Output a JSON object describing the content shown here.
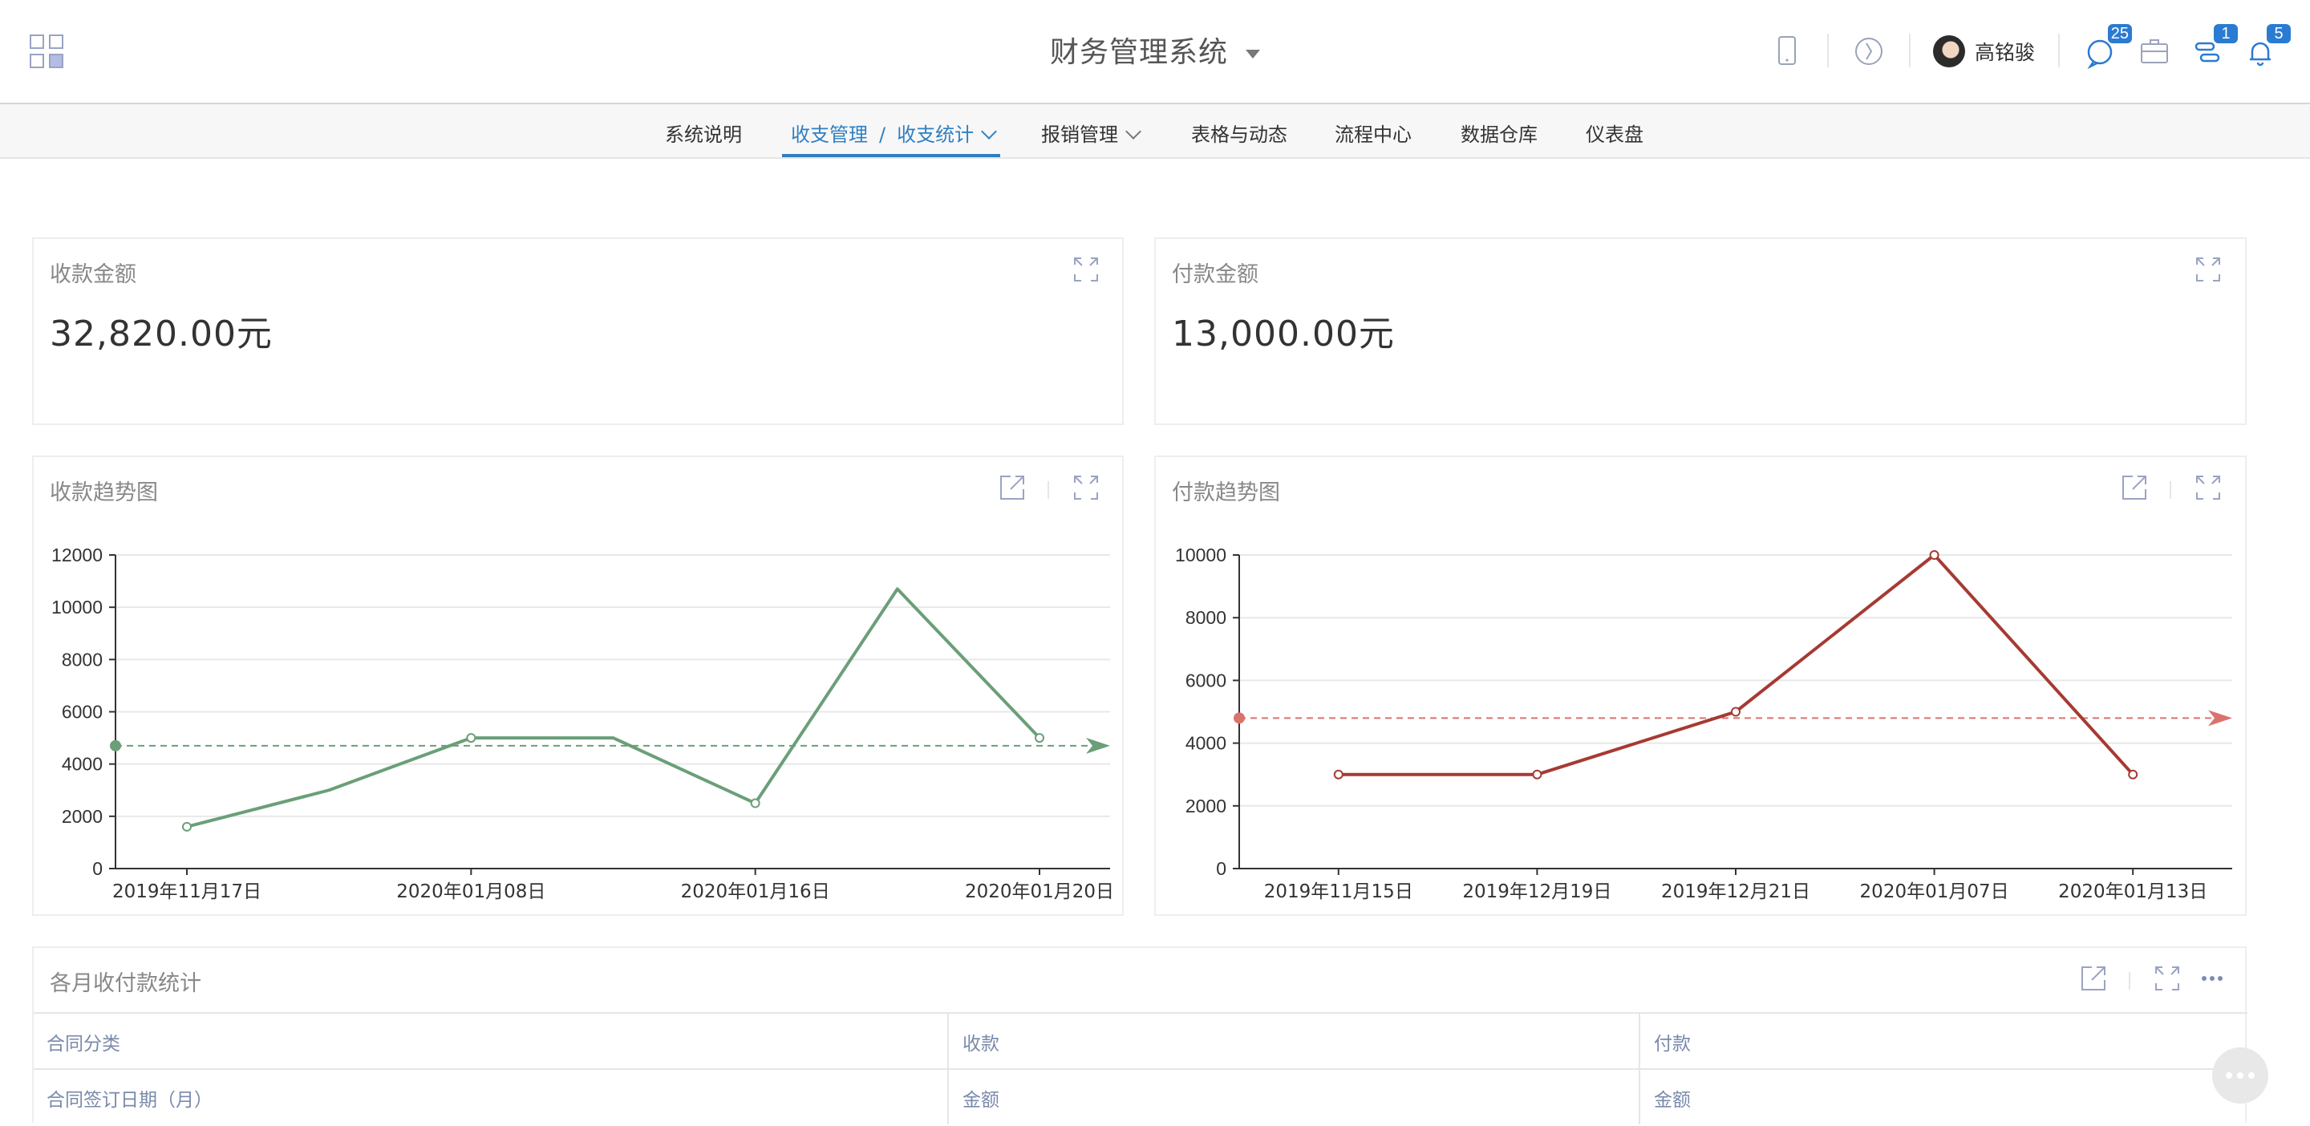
{
  "header": {
    "title": "财务管理系统",
    "user_name": "高铭骏",
    "badges": {
      "messages": "25",
      "tasks": "1",
      "notifications": "5"
    },
    "accent": "#2f7fc1"
  },
  "nav": {
    "items": [
      {
        "label": "系统说明"
      },
      {
        "label": "收支管理",
        "sub": "收支统计",
        "active": true
      },
      {
        "label": "报销管理"
      },
      {
        "label": "表格与动态"
      },
      {
        "label": "流程中心"
      },
      {
        "label": "数据仓库"
      },
      {
        "label": "仪表盘"
      }
    ],
    "separator": "/"
  },
  "kpis": {
    "receipt": {
      "title": "收款金额",
      "value": "32,820.00元"
    },
    "payment": {
      "title": "付款金额",
      "value": "13,000.00元"
    }
  },
  "charts": {
    "receipt_trend_title": "收款趋势图",
    "payment_trend_title": "付款趋势图"
  },
  "chart_data": [
    {
      "type": "line",
      "title": "收款趋势图",
      "color": "#6a9f78",
      "x_tick_labels": [
        "2019年11月17日",
        "2020年01月08日",
        "2020年01月16日",
        "2020年01月20日"
      ],
      "points": [
        {
          "x": "2019年11月17日",
          "y": 1600
        },
        {
          "x": "",
          "y": 3000
        },
        {
          "x": "2020年01月08日",
          "y": 5000
        },
        {
          "x": "",
          "y": 5000
        },
        {
          "x": "2020年01月16日",
          "y": 2500
        },
        {
          "x": "",
          "y": 10700
        },
        {
          "x": "2020年01月20日",
          "y": 5000
        }
      ],
      "y_ticks": [
        0,
        2000,
        4000,
        6000,
        8000,
        10000,
        12000
      ],
      "ylim": [
        0,
        12000
      ],
      "average_line": 4700,
      "grid": true
    },
    {
      "type": "line",
      "title": "付款趋势图",
      "color": "#a63a33",
      "average_color": "#d9736c",
      "categories": [
        "2019年11月15日",
        "2019年12月19日",
        "2019年12月21日",
        "2020年01月07日",
        "2020年01月13日"
      ],
      "values": [
        3000,
        3000,
        5000,
        10000,
        3000
      ],
      "y_ticks": [
        0,
        2000,
        4000,
        6000,
        8000,
        10000
      ],
      "ylim": [
        0,
        10000
      ],
      "average_line": 4800,
      "grid": true
    }
  ],
  "table": {
    "title": "各月收付款统计",
    "header_row1": [
      "合同分类",
      "收款",
      "付款"
    ],
    "header_row2": [
      "合同签订日期（月）",
      "金额",
      "金额"
    ]
  }
}
